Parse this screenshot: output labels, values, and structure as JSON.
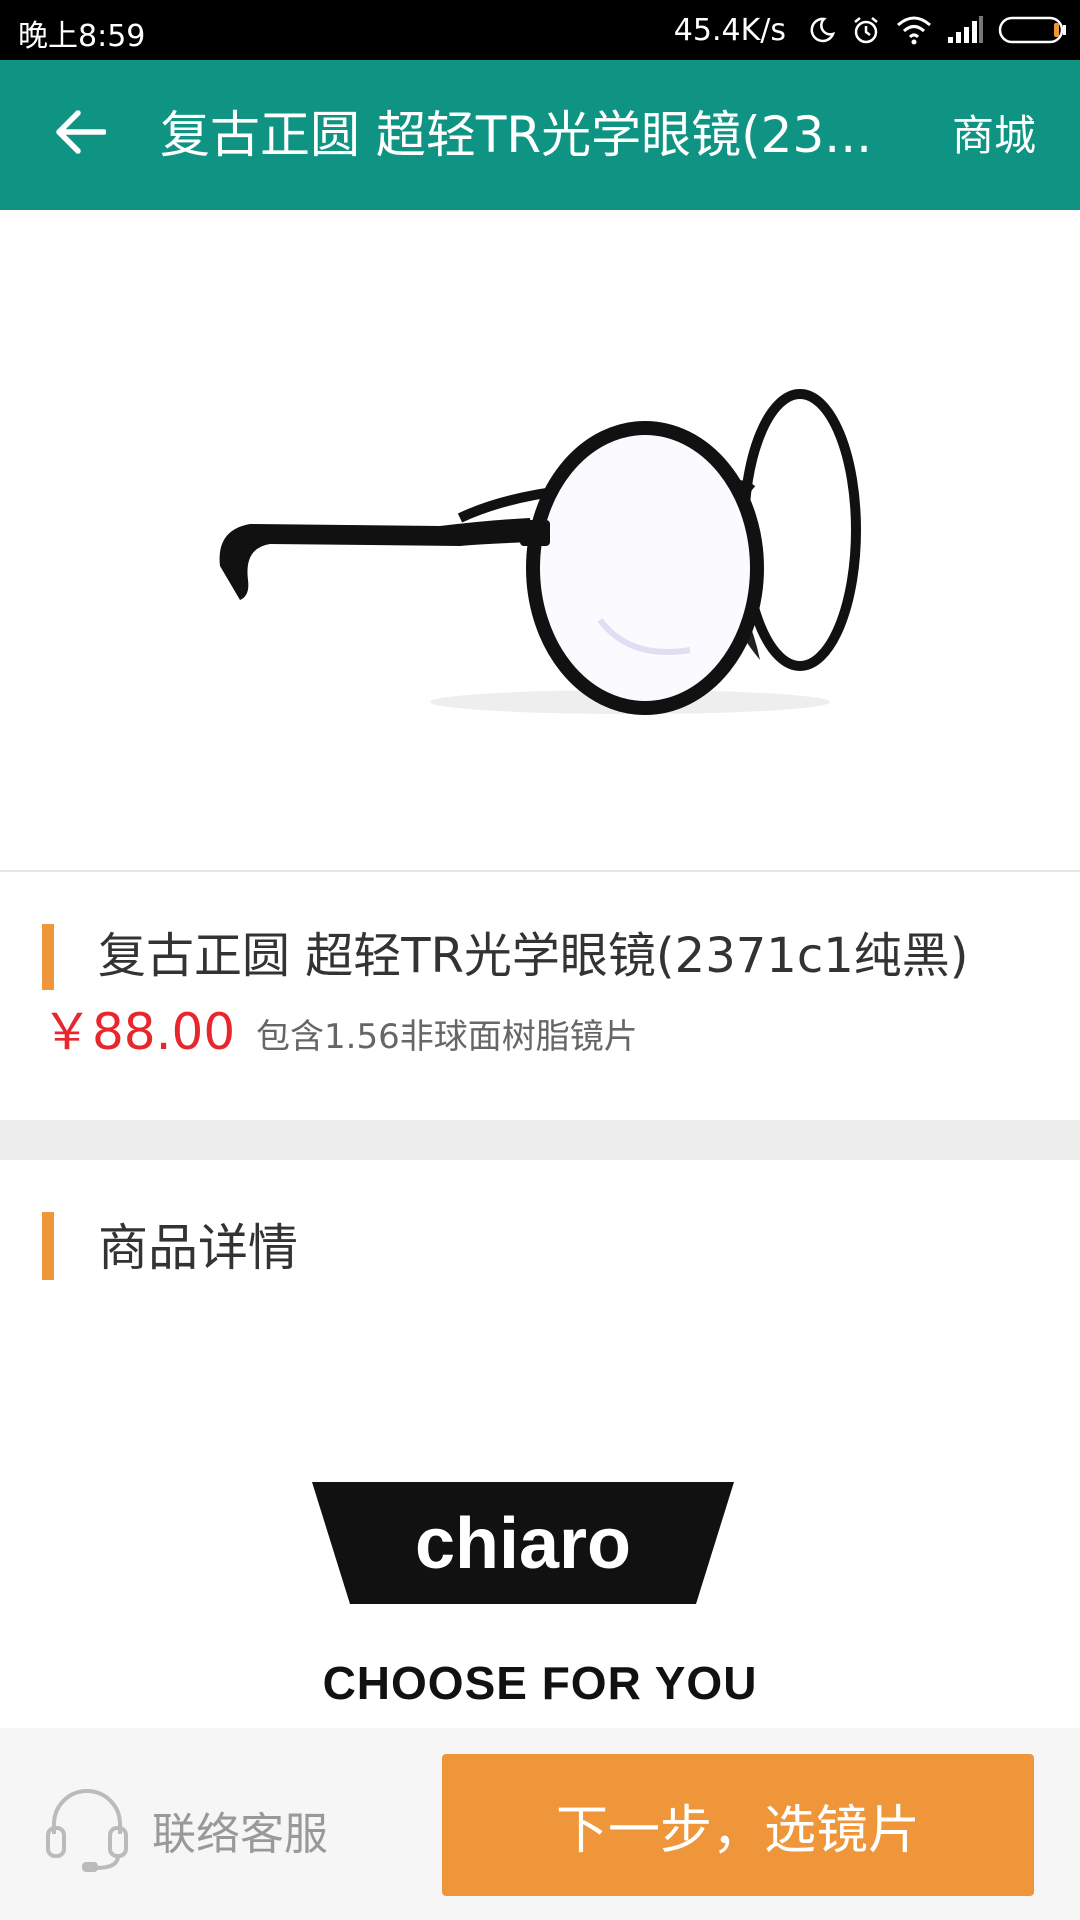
{
  "status_bar": {
    "time": "晚上8:59",
    "network_speed": "45.4K/s",
    "icons": [
      "moon-icon",
      "alarm-icon",
      "wifi-icon",
      "signal-icon",
      "battery-icon"
    ]
  },
  "app_bar": {
    "back_icon": "arrow-left-icon",
    "title": "复古正圆 超轻TR光学眼镜(23...",
    "right_link": "商城",
    "color": "#0f9484"
  },
  "product": {
    "title": "复古正圆 超轻TR光学眼镜(2371c1纯黑)",
    "price": "￥88.00",
    "price_note": "包含1.56非球面树脂镜片",
    "price_color": "#e8262d",
    "accent_color": "#f0963a"
  },
  "details": {
    "heading": "商品详情",
    "brand_logo_text": "chiaro",
    "tagline": "CHOOSE FOR YOU"
  },
  "bottom_bar": {
    "service_icon": "headset-icon",
    "service_label": "联络客服",
    "next_button": "下一步，选镜片",
    "button_color": "#f0963a"
  }
}
